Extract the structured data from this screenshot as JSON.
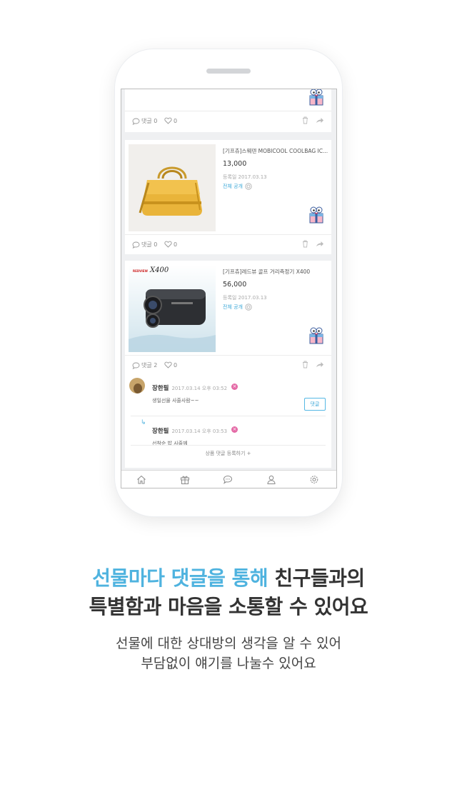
{
  "colors": {
    "accent": "#4fb3df",
    "text_dark": "#333333",
    "delete_badge": "#e46aa6"
  },
  "posts": [
    {
      "comment_label": "댓글 0",
      "like_count": "0"
    },
    {
      "product_name": "[기프츄]스웨덴 MOBICOOL COOLBAG IC...",
      "price": "13,000",
      "date": "등록일 2017.03.13",
      "visibility": "전체 공개",
      "comment_label": "댓글 0",
      "like_count": "0"
    },
    {
      "product_name": "[기프츄]레드뷰 골프 거리측정기 X400",
      "price": "56,000",
      "date": "등록일 2017.03.13",
      "visibility": "전체 공개",
      "product_image_text": "X400",
      "product_brand_text": "REDVIEW",
      "comment_label": "댓글 2",
      "like_count": "0",
      "comments": [
        {
          "author": "장한필",
          "time": "2017.03.14 오후 03:52",
          "text": "생일선물 사줄사람~~",
          "reply_label": "댓글"
        },
        {
          "author": "장한필",
          "time": "2017.03.14 오후 03:53",
          "text": "선착순 밥 사줄께"
        }
      ],
      "add_comment_label": "상품 댓글 등록하기 +"
    }
  ],
  "tabs": [
    "home-icon",
    "gift-icon",
    "chat-icon",
    "profile-icon",
    "settings-icon"
  ],
  "headline": {
    "part1": "선물마다 댓글을 통해",
    "part2": " 친구들과의",
    "line2": "특별함과 마음을 소통할 수 있어요"
  },
  "sub": {
    "line1": "선물에 대한 상대방의 생각을 알 수 있어",
    "line2": "부담없이 얘기를 나눌수 있어요"
  }
}
